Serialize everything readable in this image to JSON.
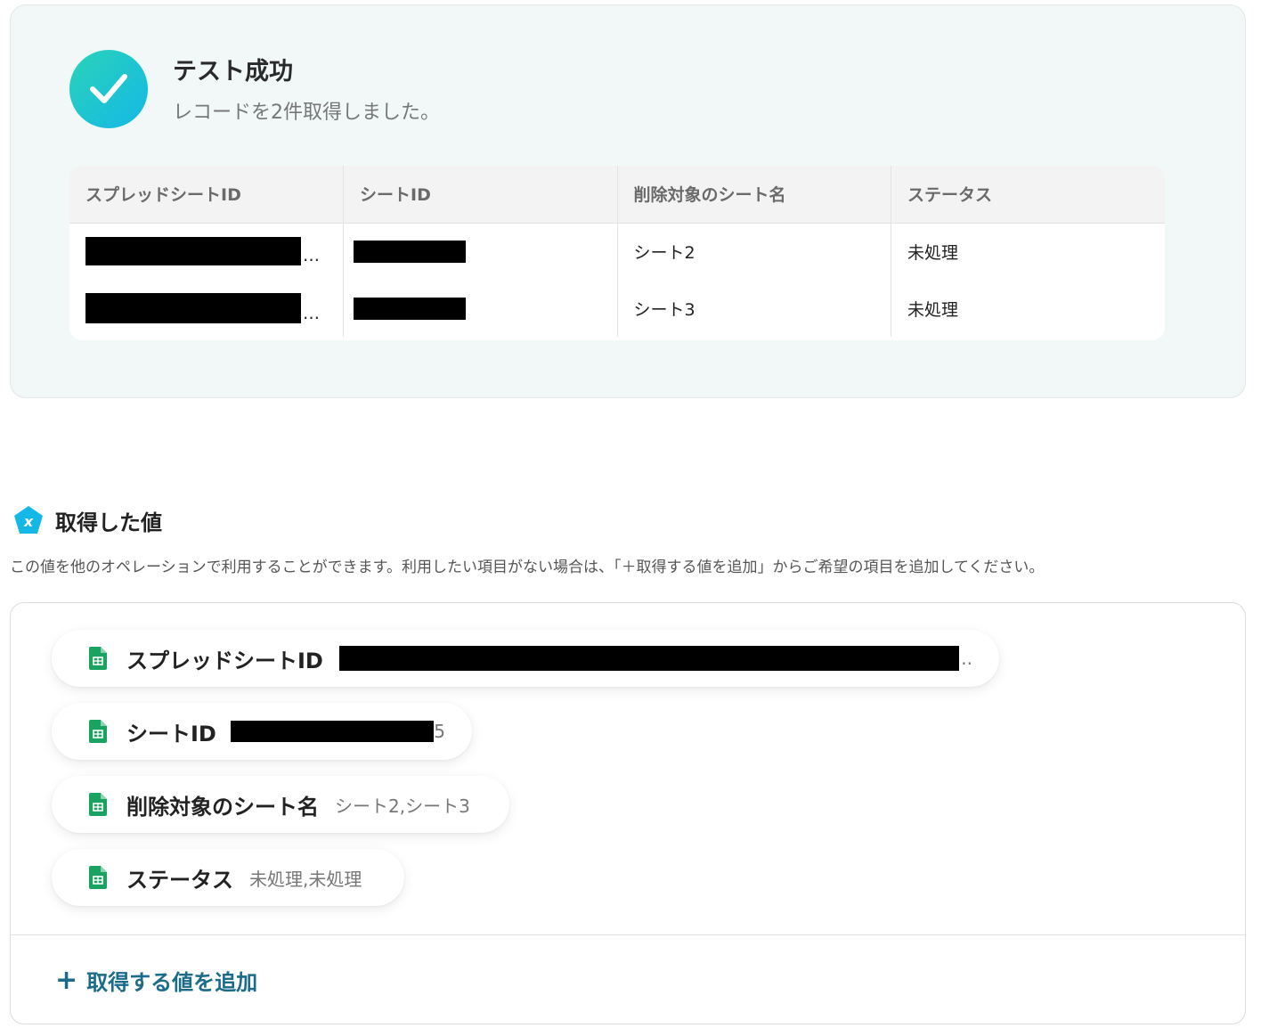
{
  "success": {
    "title": "テスト成功",
    "subtitle": "レコードを2件取得しました。",
    "icon": "check-icon",
    "accent_colors": [
      "#2bd3b8",
      "#13b8e6"
    ]
  },
  "table": {
    "columns": [
      "スプレッドシートID",
      "シートID",
      "削除対象のシート名",
      "ステータス"
    ],
    "rows": [
      {
        "spreadsheet_id_suffix": "…",
        "sheet_name": "シート2",
        "status": "未処理"
      },
      {
        "spreadsheet_id_suffix": "…",
        "sheet_name": "シート3",
        "status": "未処理"
      }
    ]
  },
  "values": {
    "title": "取得した値",
    "icon": "variable-icon",
    "description": "この値を他のオペレーションで利用することができます。利用したい項目がない場合は、「＋取得する値を追加」からご希望の項目を追加してください。",
    "items": [
      {
        "label": "スプレッドシートID",
        "value_suffix": ".."
      },
      {
        "label": "シートID",
        "value_suffix": "5"
      },
      {
        "label": "削除対象のシート名",
        "value": "シート2,シート3"
      },
      {
        "label": "ステータス",
        "value": "未処理,未処理"
      }
    ],
    "add_button_label": "取得する値を追加",
    "link_color": "#1b6b8a",
    "sheet_icon": "google-sheets-icon"
  }
}
